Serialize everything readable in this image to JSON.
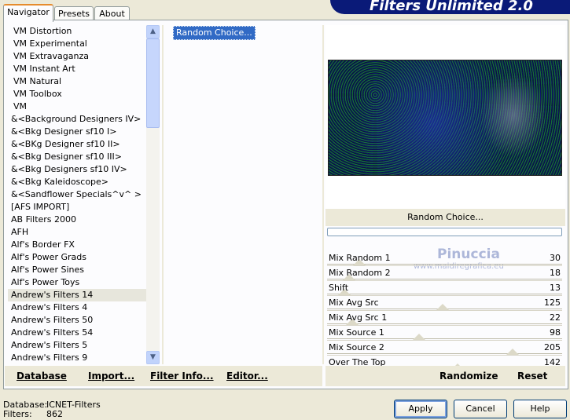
{
  "header": {
    "title": "Filters Unlimited 2.0"
  },
  "tabs": [
    {
      "label": "Navigator",
      "active": true
    },
    {
      "label": "Presets",
      "active": false
    },
    {
      "label": "About",
      "active": false
    }
  ],
  "categories": [
    "VM Distortion",
    "VM Experimental",
    "VM Extravaganza",
    "VM Instant Art",
    "VM Natural",
    "VM Toolbox",
    "VM",
    "&<Background Designers IV>",
    "&<Bkg Designer sf10 I>",
    "&<BKg Designer sf10 II>",
    "&<Bkg Designer sf10 III>",
    "&<Bkg Designers sf10 IV>",
    "&<Bkg Kaleidoscope>",
    "&<Sandflower Specials^v^ >",
    "[AFS IMPORT]",
    "AB Filters 2000",
    "AFH",
    "Alf's Border FX",
    "Alf's Power Grads",
    "Alf's Power Sines",
    "Alf's Power Toys",
    "Andrew's Filters 14",
    "Andrew's Filters 4",
    "Andrew's Filters 50",
    "Andrew's Filters 54",
    "Andrew's Filters 5",
    "Andrew's Filters 9"
  ],
  "selected_category": "Andrew's Filters 14",
  "filters": {
    "selected": "Random Choice..."
  },
  "preview": {
    "filter_name": "Random Choice..."
  },
  "sliders": [
    {
      "name": "Mix Random 1",
      "value": 30
    },
    {
      "name": "Mix Random 2",
      "value": 18
    },
    {
      "name": "Shift",
      "value": 13
    },
    {
      "name": "Mix Avg Src",
      "value": 125
    },
    {
      "name": "Mix Avg Src 1",
      "value": 22
    },
    {
      "name": "Mix Source 1",
      "value": 98
    },
    {
      "name": "Mix Source 2",
      "value": 205
    },
    {
      "name": "Over The Top",
      "value": 142
    }
  ],
  "slider_max": 255,
  "left_buttons": {
    "database": "Database",
    "import": "Import...",
    "filter_info": "Filter Info...",
    "editor": "Editor..."
  },
  "right_buttons": {
    "randomize": "Randomize",
    "reset": "Reset"
  },
  "status": {
    "database_label": "Database:",
    "database_value": "ICNET-Filters",
    "filters_label": "Filters:",
    "filters_value": "862"
  },
  "dialog": {
    "apply": "Apply",
    "cancel": "Cancel",
    "help": "Help"
  },
  "watermark": {
    "name": "Pinuccia",
    "url": "www.maidiregrafica.eu"
  }
}
